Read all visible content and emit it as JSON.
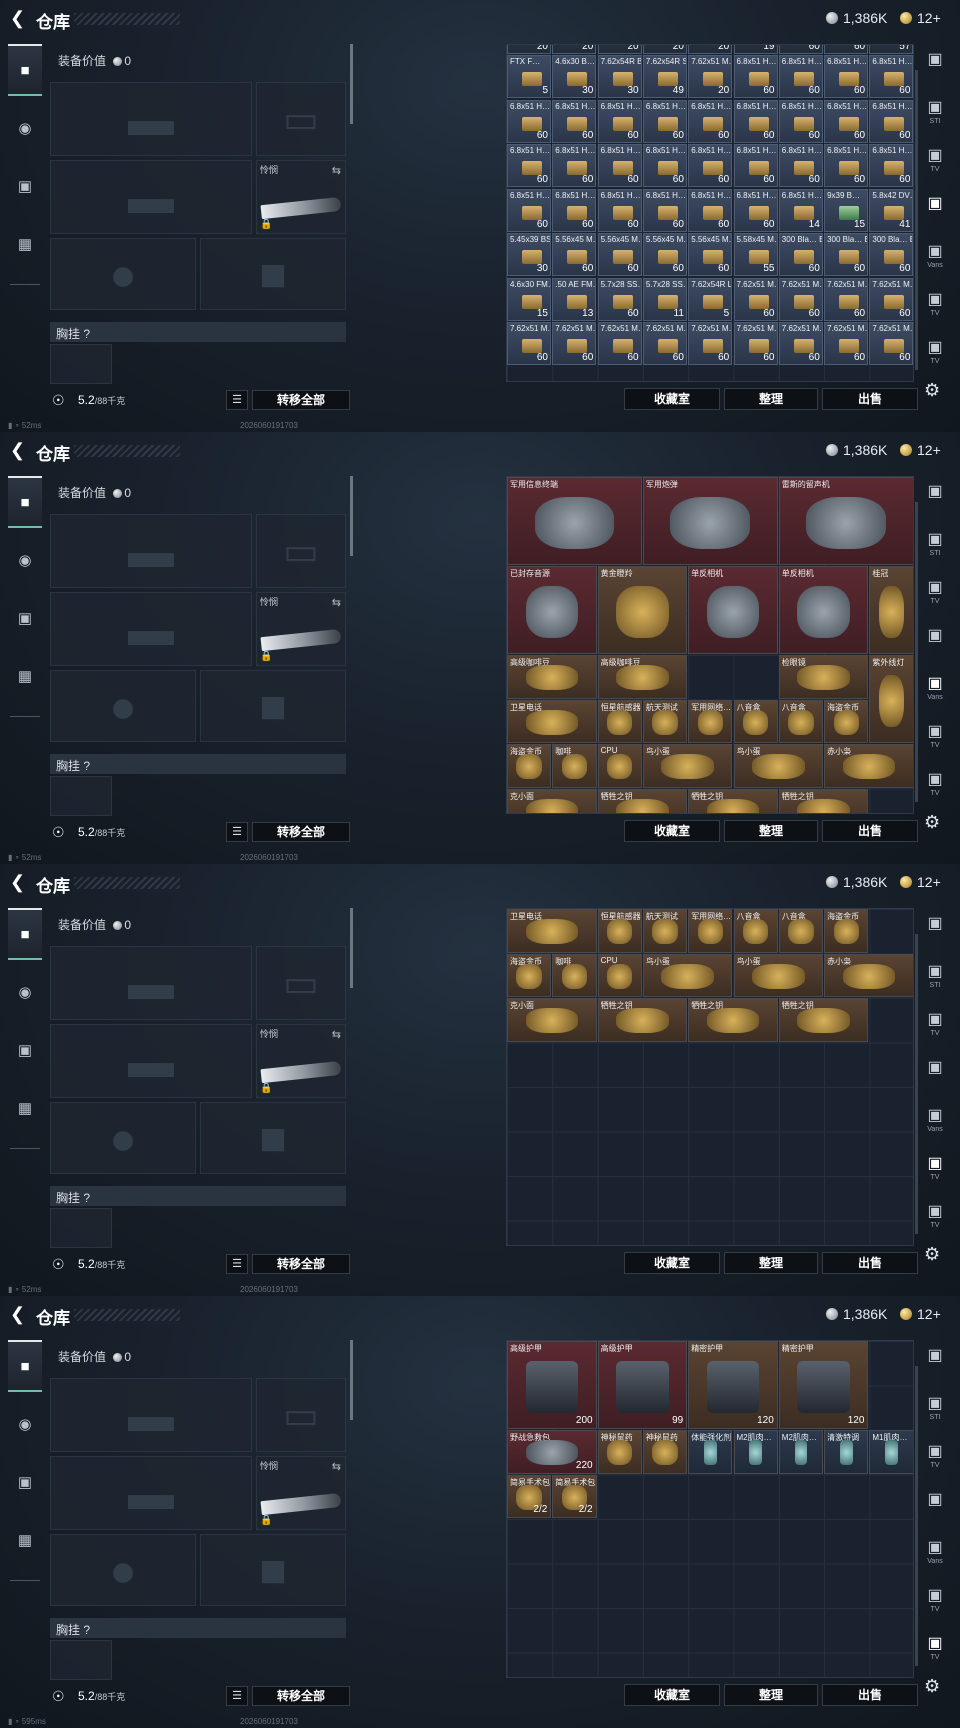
{
  "header": {
    "title": "仓库",
    "silver": "1,386K",
    "gold": "12+"
  },
  "gear": {
    "value_label": "装备价值",
    "value": "0",
    "knife_label": "怜悯",
    "vest_label": "胸挂 ?",
    "weight": "5.2",
    "weight_max": "/88千克",
    "move_all": "转移全部"
  },
  "actions": {
    "collect": "收藏室",
    "sort": "整理",
    "sell": "出售"
  },
  "status": [
    {
      "ping": "52ms",
      "ver": "2026060191703"
    },
    {
      "ping": "52ms",
      "ver": "2026060191703"
    },
    {
      "ping": "52ms",
      "ver": "2026060191703"
    },
    {
      "ping": "595ms",
      "ver": "2026060191703"
    }
  ],
  "tabs": [
    {
      "label": "",
      "icon": "helmet-icon"
    },
    {
      "label": "STI",
      "icon": "gear-bag-icon"
    },
    {
      "label": "TV",
      "icon": "tv-icon"
    },
    {
      "label": "",
      "icon": "ammo-icon"
    },
    {
      "label": "Vans",
      "icon": "van-icon"
    },
    {
      "label": "TV",
      "icon": "tv-icon"
    },
    {
      "label": "TV",
      "icon": "tv-icon"
    }
  ],
  "panel1_ammo": [
    [
      "20",
      "20",
      "20",
      "20",
      "20",
      "19",
      "60",
      "60",
      "57"
    ],
    [
      [
        "FTX F…",
        "5"
      ],
      [
        "4.6x30 B…",
        "30"
      ],
      [
        "7.62x54R B…",
        "30"
      ],
      [
        "7.62x54R S…",
        "49"
      ],
      [
        "7.62x51 M…",
        "20"
      ],
      [
        "6.8x51 H…",
        "60"
      ],
      [
        "6.8x51 H…",
        "60"
      ],
      [
        "6.8x51 H…",
        "60"
      ],
      [
        "6.8x51 H…",
        "60"
      ]
    ],
    [
      [
        "6.8x51 H…",
        "60"
      ],
      [
        "6.8x51 H…",
        "60"
      ],
      [
        "6.8x51 H…",
        "60"
      ],
      [
        "6.8x51 H…",
        "60"
      ],
      [
        "6.8x51 H…",
        "60"
      ],
      [
        "6.8x51 H…",
        "60"
      ],
      [
        "6.8x51 H…",
        "60"
      ],
      [
        "6.8x51 H…",
        "60"
      ],
      [
        "6.8x51 H…",
        "60"
      ]
    ],
    [
      [
        "6.8x51 H…",
        "60"
      ],
      [
        "6.8x51 H…",
        "60"
      ],
      [
        "6.8x51 H…",
        "60"
      ],
      [
        "6.8x51 H…",
        "60"
      ],
      [
        "6.8x51 H…",
        "60"
      ],
      [
        "6.8x51 H…",
        "60"
      ],
      [
        "6.8x51 H…",
        "60"
      ],
      [
        "6.8x51 H…",
        "60"
      ],
      [
        "6.8x51 H…",
        "60"
      ]
    ],
    [
      [
        "6.8x51 H…",
        "60"
      ],
      [
        "6.8x51 H…",
        "60"
      ],
      [
        "6.8x51 H…",
        "60"
      ],
      [
        "6.8x51 H…",
        "60"
      ],
      [
        "6.8x51 H…",
        "60"
      ],
      [
        "6.8x51 H…",
        "60"
      ],
      [
        "6.8x51 H…",
        "14"
      ],
      [
        "9x39 B…",
        "15"
      ],
      [
        "5.8x42 DV…",
        "41"
      ]
    ],
    [
      [
        "5.45x39 BS…",
        "30"
      ],
      [
        "5.56x45 M…",
        "60"
      ],
      [
        "5.56x45 M…",
        "60"
      ],
      [
        "5.56x45 M…",
        "60"
      ],
      [
        "5.56x45 M…",
        "60"
      ],
      [
        "5.58x45 M…",
        "55"
      ],
      [
        "300 Bla… BC…",
        "60"
      ],
      [
        "300 Bla… BC…",
        "60"
      ],
      [
        "300 Bla… BC…",
        "60"
      ]
    ],
    [
      [
        "4.6x30 FM…",
        "15"
      ],
      [
        ".50 AE FM…",
        "13"
      ],
      [
        "5.7x28 SS…",
        "60"
      ],
      [
        "5.7x28 SS…",
        "11"
      ],
      [
        "7.62x54R L…",
        "5"
      ],
      [
        "7.62x51 M…",
        "60"
      ],
      [
        "7.62x51 M…",
        "60"
      ],
      [
        "7.62x51 M…",
        "60"
      ],
      [
        "7.62x51 M…",
        "60"
      ]
    ],
    [
      [
        "7.62x51 M…",
        "60"
      ],
      [
        "7.62x51 M…",
        "60"
      ],
      [
        "7.62x51 M…",
        "60"
      ],
      [
        "7.62x51 M…",
        "60"
      ],
      [
        "7.62x51 M…",
        "60"
      ],
      [
        "7.62x51 M…",
        "60"
      ],
      [
        "7.62x51 M…",
        "60"
      ],
      [
        "7.62x51 M…",
        "60"
      ],
      [
        "7.62x51 M…",
        "60"
      ]
    ]
  ],
  "panel2_items": [
    {
      "n": "军用信息终端",
      "t": "red",
      "c": 0,
      "r": 0,
      "w": 3,
      "h": 2
    },
    {
      "n": "军用炮弹",
      "t": "red",
      "c": 3,
      "r": 0,
      "w": 3,
      "h": 2
    },
    {
      "n": "雷斯的留声机",
      "t": "red",
      "c": 6,
      "r": 0,
      "w": 3,
      "h": 2
    },
    {
      "n": "已封存音源",
      "t": "red",
      "c": 0,
      "r": 2,
      "w": 2,
      "h": 2
    },
    {
      "n": "黄金瞪羚",
      "t": "gold",
      "c": 2,
      "r": 2,
      "w": 2,
      "h": 2
    },
    {
      "n": "单反相机",
      "t": "red",
      "c": 4,
      "r": 2,
      "w": 2,
      "h": 2
    },
    {
      "n": "单反相机",
      "t": "red",
      "c": 6,
      "r": 2,
      "w": 2,
      "h": 2
    },
    {
      "n": "桂冠",
      "t": "gold",
      "c": 8,
      "r": 2,
      "w": 1,
      "h": 2
    },
    {
      "n": "高级咖啡豆",
      "t": "gold",
      "c": 0,
      "r": 4,
      "w": 2,
      "h": 1
    },
    {
      "n": "高级咖啡豆",
      "t": "gold",
      "c": 2,
      "r": 4,
      "w": 2,
      "h": 1
    },
    {
      "n": "检眼镜",
      "t": "gold",
      "c": 6,
      "r": 4,
      "w": 2,
      "h": 1
    },
    {
      "n": "紫外线灯",
      "t": "gold",
      "c": 8,
      "r": 4,
      "w": 1,
      "h": 2
    },
    {
      "n": "卫星电话",
      "t": "gold",
      "c": 0,
      "r": 5,
      "w": 2,
      "h": 1
    },
    {
      "n": "恒星航感器",
      "t": "gold",
      "c": 2,
      "r": 5,
      "w": 1,
      "h": 1
    },
    {
      "n": "航天测试",
      "t": "gold",
      "c": 3,
      "r": 5,
      "w": 1,
      "h": 1
    },
    {
      "n": "军用网络…",
      "t": "gold",
      "c": 4,
      "r": 5,
      "w": 1,
      "h": 1
    },
    {
      "n": "八音盒",
      "t": "gold",
      "c": 5,
      "r": 5,
      "w": 1,
      "h": 1
    },
    {
      "n": "八音盒",
      "t": "gold",
      "c": 6,
      "r": 5,
      "w": 1,
      "h": 1
    },
    {
      "n": "海盗金币",
      "t": "gold",
      "c": 7,
      "r": 5,
      "w": 1,
      "h": 1
    },
    {
      "n": "海盗金币",
      "t": "gold",
      "c": 0,
      "r": 6,
      "w": 1,
      "h": 1
    },
    {
      "n": "咖啡",
      "t": "gold",
      "c": 1,
      "r": 6,
      "w": 1,
      "h": 1
    },
    {
      "n": "CPU",
      "t": "gold",
      "c": 2,
      "r": 6,
      "w": 1,
      "h": 1
    },
    {
      "n": "鸟小蛋",
      "t": "gold",
      "c": 3,
      "r": 6,
      "w": 2,
      "h": 1
    },
    {
      "n": "鸟小蛋",
      "t": "gold",
      "c": 5,
      "r": 6,
      "w": 2,
      "h": 1
    },
    {
      "n": "赤小枭",
      "t": "gold",
      "c": 7,
      "r": 6,
      "w": 2,
      "h": 1
    },
    {
      "n": "克小面",
      "t": "gold",
      "c": 0,
      "r": 7,
      "w": 2,
      "h": 1
    },
    {
      "n": "牺牲之钥",
      "t": "gold",
      "c": 2,
      "r": 7,
      "w": 2,
      "h": 1
    },
    {
      "n": "牺牲之钥",
      "t": "gold",
      "c": 4,
      "r": 7,
      "w": 2,
      "h": 1
    },
    {
      "n": "牺牲之钥",
      "t": "gold",
      "c": 6,
      "r": 7,
      "w": 2,
      "h": 1
    }
  ],
  "panel3_items": [
    {
      "n": "卫星电话",
      "t": "gold",
      "c": 0,
      "r": 0,
      "w": 2,
      "h": 1
    },
    {
      "n": "恒星航感器",
      "t": "gold",
      "c": 2,
      "r": 0,
      "w": 1,
      "h": 1
    },
    {
      "n": "航天测试",
      "t": "gold",
      "c": 3,
      "r": 0,
      "w": 1,
      "h": 1
    },
    {
      "n": "军用网络…",
      "t": "gold",
      "c": 4,
      "r": 0,
      "w": 1,
      "h": 1
    },
    {
      "n": "八音盒",
      "t": "gold",
      "c": 5,
      "r": 0,
      "w": 1,
      "h": 1
    },
    {
      "n": "八音盒",
      "t": "gold",
      "c": 6,
      "r": 0,
      "w": 1,
      "h": 1
    },
    {
      "n": "海盗金币",
      "t": "gold",
      "c": 7,
      "r": 0,
      "w": 1,
      "h": 1
    },
    {
      "n": "海盗金币",
      "t": "gold",
      "c": 0,
      "r": 1,
      "w": 1,
      "h": 1
    },
    {
      "n": "咖啡",
      "t": "gold",
      "c": 1,
      "r": 1,
      "w": 1,
      "h": 1
    },
    {
      "n": "CPU",
      "t": "gold",
      "c": 2,
      "r": 1,
      "w": 1,
      "h": 1
    },
    {
      "n": "鸟小蛋",
      "t": "gold",
      "c": 3,
      "r": 1,
      "w": 2,
      "h": 1
    },
    {
      "n": "鸟小蛋",
      "t": "gold",
      "c": 5,
      "r": 1,
      "w": 2,
      "h": 1
    },
    {
      "n": "赤小枭",
      "t": "gold",
      "c": 7,
      "r": 1,
      "w": 2,
      "h": 1
    },
    {
      "n": "克小面",
      "t": "gold",
      "c": 0,
      "r": 2,
      "w": 2,
      "h": 1
    },
    {
      "n": "牺牲之钥",
      "t": "gold",
      "c": 2,
      "r": 2,
      "w": 2,
      "h": 1
    },
    {
      "n": "牺牲之钥",
      "t": "gold",
      "c": 4,
      "r": 2,
      "w": 2,
      "h": 1
    },
    {
      "n": "牺牲之钥",
      "t": "gold",
      "c": 6,
      "r": 2,
      "w": 2,
      "h": 1
    }
  ],
  "panel4_items": [
    {
      "n": "高级护甲",
      "t": "red armor",
      "c": 0,
      "r": 0,
      "w": 2,
      "h": 2,
      "v": "200"
    },
    {
      "n": "高级护甲",
      "t": "red armor",
      "c": 2,
      "r": 0,
      "w": 2,
      "h": 2,
      "v": "99"
    },
    {
      "n": "精密护甲",
      "t": "gold armor",
      "c": 4,
      "r": 0,
      "w": 2,
      "h": 2,
      "v": "120"
    },
    {
      "n": "精密护甲",
      "t": "gold armor",
      "c": 6,
      "r": 0,
      "w": 2,
      "h": 2,
      "v": "120"
    },
    {
      "n": "野战急救包",
      "t": "red",
      "c": 0,
      "r": 2,
      "w": 2,
      "h": 1,
      "v": "220"
    },
    {
      "n": "神秘鼠药",
      "t": "gold",
      "c": 2,
      "r": 2,
      "w": 1,
      "h": 1,
      "v": ""
    },
    {
      "n": "神秘鼠药",
      "t": "gold",
      "c": 3,
      "r": 2,
      "w": 1,
      "h": 1,
      "v": ""
    },
    {
      "n": "体能强化剂",
      "t": "blue",
      "c": 4,
      "r": 2,
      "w": 1,
      "h": 1,
      "v": ""
    },
    {
      "n": "M2肌肉…",
      "t": "blue",
      "c": 5,
      "r": 2,
      "w": 1,
      "h": 1,
      "v": ""
    },
    {
      "n": "M2肌肉…",
      "t": "blue",
      "c": 6,
      "r": 2,
      "w": 1,
      "h": 1,
      "v": ""
    },
    {
      "n": "清激特调",
      "t": "blue",
      "c": 7,
      "r": 2,
      "w": 1,
      "h": 1,
      "v": ""
    },
    {
      "n": "M1肌肉…",
      "t": "blue",
      "c": 8,
      "r": 2,
      "w": 1,
      "h": 1,
      "v": ""
    },
    {
      "n": "简易手术包",
      "t": "gold",
      "c": 0,
      "r": 3,
      "w": 1,
      "h": 1,
      "v": "2/2"
    },
    {
      "n": "简易手术包",
      "t": "gold",
      "c": 1,
      "r": 3,
      "w": 1,
      "h": 1,
      "v": "2/2"
    }
  ]
}
